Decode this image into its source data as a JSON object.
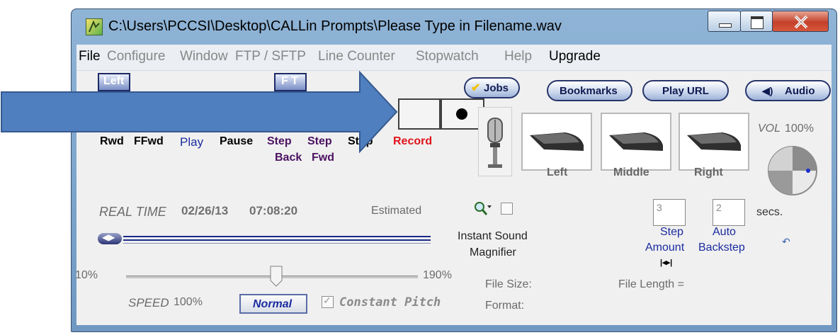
{
  "window": {
    "title": "C:\\Users\\PCCSI\\Desktop\\CALLin Prompts\\Please Type in Filename.wav"
  },
  "menu": [
    "File",
    "Configure",
    "Window",
    "FTP / SFTP",
    "Line Counter",
    "Stopwatch",
    "Help",
    "Upgrade"
  ],
  "toolbar": {
    "left_btn": "Left",
    "ft_btn": "F T",
    "jobs": "Jobs",
    "bookmarks": "Bookmarks",
    "play_url": "Play URL",
    "audio": "Audio"
  },
  "transport": {
    "rwd": "Rwd",
    "ffwd": "FFwd",
    "play": "Play",
    "pause": "Pause",
    "step_back_1": "Step",
    "step_back_2": "Back",
    "step_fwd_1": "Step",
    "step_fwd_2": "Fwd",
    "stop": "Stop",
    "record": "Record"
  },
  "pedals": {
    "left": "Left",
    "middle": "Middle",
    "right": "Right"
  },
  "volume": {
    "label": "VOL",
    "value": "100%"
  },
  "realtime": {
    "label": "REAL TIME",
    "date": "02/26/13",
    "time": "07:08:20",
    "estimated": "Estimated"
  },
  "magnifier": {
    "line1": "Instant Sound",
    "line2": "Magnifier"
  },
  "step": {
    "amount_value": "3",
    "backstep_value": "2",
    "secs": "secs.",
    "step_label_1": "Step",
    "step_label_2": "Amount",
    "auto_label_1": "Auto",
    "auto_label_2": "Backstep"
  },
  "speed": {
    "min": "10%",
    "max": "190%",
    "label": "SPEED",
    "value": "100%",
    "normal_btn": "Normal",
    "constant_pitch": "Constant Pitch",
    "slider_value_percent": 100
  },
  "file": {
    "size_label": "File Size:",
    "format_label": "Format:",
    "length_label": "File Length ="
  },
  "colors": {
    "arrow_fill": "#4f7fbf",
    "play_text": "#1a2c9f",
    "record_text": "#e0121a",
    "step_text": "#4b1261"
  }
}
